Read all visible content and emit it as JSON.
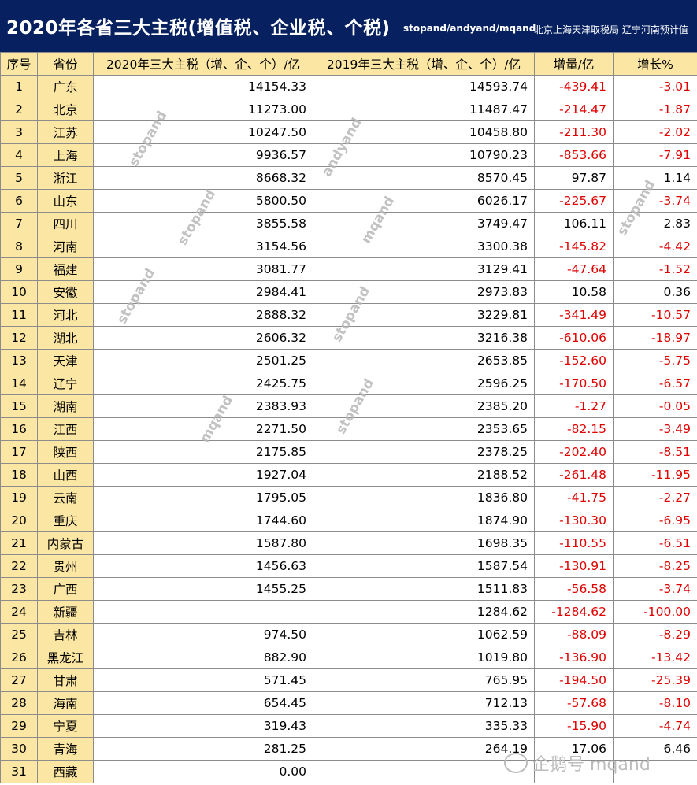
{
  "title": "2020年各省三大主税(增值税、企业税、个税)",
  "subtitle": "stopand/andyand/mqand",
  "source_note": "北京上海天津取税局  辽宁河南预计值",
  "headers": [
    "序号",
    "省份",
    "2020年三大主税（增、企、个）/亿",
    "2019年三大主税（增、企、个）/亿",
    "增量/亿",
    "增长%"
  ],
  "rows": [
    {
      "idx": "1",
      "prov": "广东",
      "v2020": "14154.33",
      "v2019": "14593.74",
      "inc": "-439.41",
      "pct": "-3.01"
    },
    {
      "idx": "2",
      "prov": "北京",
      "v2020": "11273.00",
      "v2019": "11487.47",
      "inc": "-214.47",
      "pct": "-1.87"
    },
    {
      "idx": "3",
      "prov": "江苏",
      "v2020": "10247.50",
      "v2019": "10458.80",
      "inc": "-211.30",
      "pct": "-2.02"
    },
    {
      "idx": "4",
      "prov": "上海",
      "v2020": "9936.57",
      "v2019": "10790.23",
      "inc": "-853.66",
      "pct": "-7.91"
    },
    {
      "idx": "5",
      "prov": "浙江",
      "v2020": "8668.32",
      "v2019": "8570.45",
      "inc": "97.87",
      "pct": "1.14"
    },
    {
      "idx": "6",
      "prov": "山东",
      "v2020": "5800.50",
      "v2019": "6026.17",
      "inc": "-225.67",
      "pct": "-3.74"
    },
    {
      "idx": "7",
      "prov": "四川",
      "v2020": "3855.58",
      "v2019": "3749.47",
      "inc": "106.11",
      "pct": "2.83"
    },
    {
      "idx": "8",
      "prov": "河南",
      "v2020": "3154.56",
      "v2019": "3300.38",
      "inc": "-145.82",
      "pct": "-4.42"
    },
    {
      "idx": "9",
      "prov": "福建",
      "v2020": "3081.77",
      "v2019": "3129.41",
      "inc": "-47.64",
      "pct": "-1.52"
    },
    {
      "idx": "10",
      "prov": "安徽",
      "v2020": "2984.41",
      "v2019": "2973.83",
      "inc": "10.58",
      "pct": "0.36"
    },
    {
      "idx": "11",
      "prov": "河北",
      "v2020": "2888.32",
      "v2019": "3229.81",
      "inc": "-341.49",
      "pct": "-10.57"
    },
    {
      "idx": "12",
      "prov": "湖北",
      "v2020": "2606.32",
      "v2019": "3216.38",
      "inc": "-610.06",
      "pct": "-18.97"
    },
    {
      "idx": "13",
      "prov": "天津",
      "v2020": "2501.25",
      "v2019": "2653.85",
      "inc": "-152.60",
      "pct": "-5.75"
    },
    {
      "idx": "14",
      "prov": "辽宁",
      "v2020": "2425.75",
      "v2019": "2596.25",
      "inc": "-170.50",
      "pct": "-6.57"
    },
    {
      "idx": "15",
      "prov": "湖南",
      "v2020": "2383.93",
      "v2019": "2385.20",
      "inc": "-1.27",
      "pct": "-0.05"
    },
    {
      "idx": "16",
      "prov": "江西",
      "v2020": "2271.50",
      "v2019": "2353.65",
      "inc": "-82.15",
      "pct": "-3.49"
    },
    {
      "idx": "17",
      "prov": "陕西",
      "v2020": "2175.85",
      "v2019": "2378.25",
      "inc": "-202.40",
      "pct": "-8.51"
    },
    {
      "idx": "18",
      "prov": "山西",
      "v2020": "1927.04",
      "v2019": "2188.52",
      "inc": "-261.48",
      "pct": "-11.95"
    },
    {
      "idx": "19",
      "prov": "云南",
      "v2020": "1795.05",
      "v2019": "1836.80",
      "inc": "-41.75",
      "pct": "-2.27"
    },
    {
      "idx": "20",
      "prov": "重庆",
      "v2020": "1744.60",
      "v2019": "1874.90",
      "inc": "-130.30",
      "pct": "-6.95"
    },
    {
      "idx": "21",
      "prov": "内蒙古",
      "v2020": "1587.80",
      "v2019": "1698.35",
      "inc": "-110.55",
      "pct": "-6.51"
    },
    {
      "idx": "22",
      "prov": "贵州",
      "v2020": "1456.63",
      "v2019": "1587.54",
      "inc": "-130.91",
      "pct": "-8.25"
    },
    {
      "idx": "23",
      "prov": "广西",
      "v2020": "1455.25",
      "v2019": "1511.83",
      "inc": "-56.58",
      "pct": "-3.74"
    },
    {
      "idx": "24",
      "prov": "新疆",
      "v2020": "",
      "v2019": "1284.62",
      "inc": "-1284.62",
      "pct": "-100.00"
    },
    {
      "idx": "25",
      "prov": "吉林",
      "v2020": "974.50",
      "v2019": "1062.59",
      "inc": "-88.09",
      "pct": "-8.29"
    },
    {
      "idx": "26",
      "prov": "黑龙江",
      "v2020": "882.90",
      "v2019": "1019.80",
      "inc": "-136.90",
      "pct": "-13.42"
    },
    {
      "idx": "27",
      "prov": "甘肃",
      "v2020": "571.45",
      "v2019": "765.95",
      "inc": "-194.50",
      "pct": "-25.39"
    },
    {
      "idx": "28",
      "prov": "海南",
      "v2020": "654.45",
      "v2019": "712.13",
      "inc": "-57.68",
      "pct": "-8.10"
    },
    {
      "idx": "29",
      "prov": "宁夏",
      "v2020": "319.43",
      "v2019": "335.33",
      "inc": "-15.90",
      "pct": "-4.74"
    },
    {
      "idx": "30",
      "prov": "青海",
      "v2020": "281.25",
      "v2019": "264.19",
      "inc": "17.06",
      "pct": "6.46"
    },
    {
      "idx": "31",
      "prov": "西藏",
      "v2020": "0.00",
      "v2019": "",
      "inc": "",
      "pct": ""
    }
  ],
  "watermarks": [
    "stopand",
    "andyand",
    "stopand",
    "mqand",
    "stopand",
    "stopand",
    "stopand",
    "stopand",
    "mqand",
    "stopand"
  ],
  "footer_watermark": "企鹅号 mqand",
  "colors": {
    "header_bg": "#062060",
    "label_bg": "#fbe7a3",
    "negative": "#e00000"
  }
}
